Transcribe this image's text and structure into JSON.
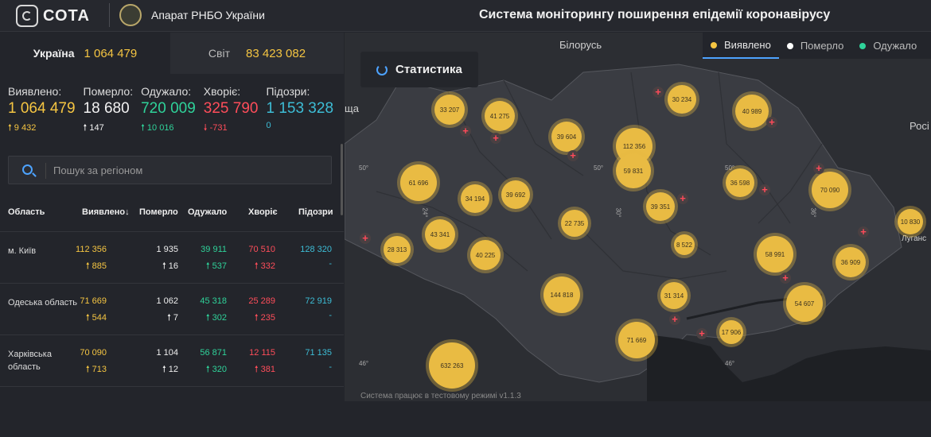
{
  "header": {
    "logo_text": "СОТА",
    "org": "Апарат РНБО України",
    "title": "Система моніторингу поширення епідемії коронавірусу"
  },
  "tabs": [
    {
      "name": "Україна",
      "value": "1 064 479"
    },
    {
      "name": "Світ",
      "value": "83 423 082"
    }
  ],
  "stats": [
    {
      "label": "Виявлено:",
      "value": "1 064 479",
      "delta": "9 432",
      "arrow": "up",
      "color": "#f5c542"
    },
    {
      "label": "Померло:",
      "value": "18 680",
      "delta": "147",
      "arrow": "up",
      "color": "#f2f2f2"
    },
    {
      "label": "Одужало:",
      "value": "720 009",
      "delta": "10 016",
      "arrow": "up",
      "color": "#2fd39a"
    },
    {
      "label": "Хворіє:",
      "value": "325 790",
      "delta": "-731",
      "arrow": "down",
      "color": "#ff4d5a"
    },
    {
      "label": "Підозри:",
      "value": "1 153 328",
      "delta": "0",
      "arrow": "",
      "color": "#3dbdd6"
    }
  ],
  "search": {
    "placeholder": "Пошук за регіоном"
  },
  "table": {
    "headers": [
      "Область",
      "Виявлено",
      "Померло",
      "Одужало",
      "Хворіє",
      "Підозри"
    ],
    "sort_arrow": "↓",
    "rows": [
      {
        "name": "м. Київ",
        "detected": "112 356",
        "detected_d": "885",
        "deaths": "1 935",
        "deaths_d": "16",
        "recovered": "39 911",
        "recovered_d": "537",
        "sick": "70 510",
        "sick_d": "332",
        "suspect": "128 320",
        "suspect_d": "-"
      },
      {
        "name": "Одеська область",
        "detected": "71 669",
        "detected_d": "544",
        "deaths": "1 062",
        "deaths_d": "7",
        "recovered": "45 318",
        "recovered_d": "302",
        "sick": "25 289",
        "sick_d": "235",
        "suspect": "72 919",
        "suspect_d": "-"
      },
      {
        "name": "Харківська область",
        "detected": "70 090",
        "detected_d": "713",
        "deaths": "1 104",
        "deaths_d": "12",
        "recovered": "56 871",
        "recovered_d": "320",
        "sick": "12 115",
        "sick_d": "381",
        "suspect": "71 135",
        "suspect_d": "-"
      }
    ]
  },
  "map": {
    "stat_button": "Статистика",
    "legend": [
      {
        "label": "Виявлено",
        "color": "#f5c542"
      },
      {
        "label": "Померло",
        "color": "#ffffff"
      },
      {
        "label": "Одужало",
        "color": "#2fd39a"
      }
    ],
    "labels": [
      "Білорусь",
      "Росі",
      "Луганс",
      "ща"
    ],
    "degrees": [
      "50°",
      "50°",
      "50°",
      "24°",
      "30°",
      "36°",
      "46°",
      "46°"
    ],
    "clusters": [
      "33 207",
      "41 275",
      "30 234",
      "40 989",
      "39 604",
      "112 356",
      "59 831",
      "61 696",
      "34 194",
      "39 692",
      "36 598",
      "70 090",
      "39 351",
      "22 735",
      "43 341",
      "28 313",
      "40 225",
      "8 522",
      "58 991",
      "36 909",
      "10 830",
      "144 818",
      "31 314",
      "54 607",
      "17 906",
      "71 669",
      "632 263"
    ],
    "footer": "Система працює в тестовому режимі v1.1.3"
  }
}
